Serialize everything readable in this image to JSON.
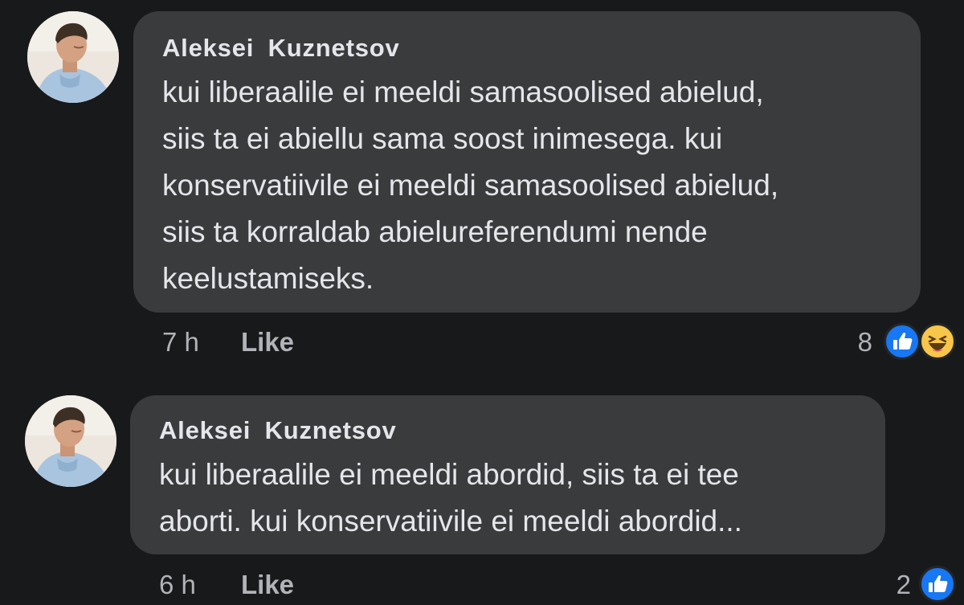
{
  "comments": [
    {
      "author": "Aleksei  Kuznetsov",
      "lines": [
        "kui liberaalile ei meeldi samasoolised abielud,",
        "siis ta ei abiellu sama soost inimesega. kui",
        "konservatiivile ei meeldi samasoolised abielud,",
        "siis ta korraldab abielureferendumi nende",
        "keelustamiseks."
      ],
      "time": "7 h",
      "like_label": "Like",
      "reaction_count": "8",
      "reactions": [
        "like-icon",
        "haha-icon"
      ]
    },
    {
      "author": "Aleksei  Kuznetsov",
      "lines": [
        "kui liberaalile ei meeldi abordid, siis ta ei tee",
        "aborti. kui konservatiivile ei meeldi abordid..."
      ],
      "time": "6 h",
      "like_label": "Like",
      "reaction_count": "2",
      "reactions": [
        "like-icon"
      ]
    }
  ],
  "colors": {
    "background": "#18191a",
    "bubble": "#3a3b3c",
    "text": "#e4e6eb",
    "meta": "#b0b3b8",
    "like_blue": "#1877f2",
    "haha_yellow": "#f7c64a"
  }
}
